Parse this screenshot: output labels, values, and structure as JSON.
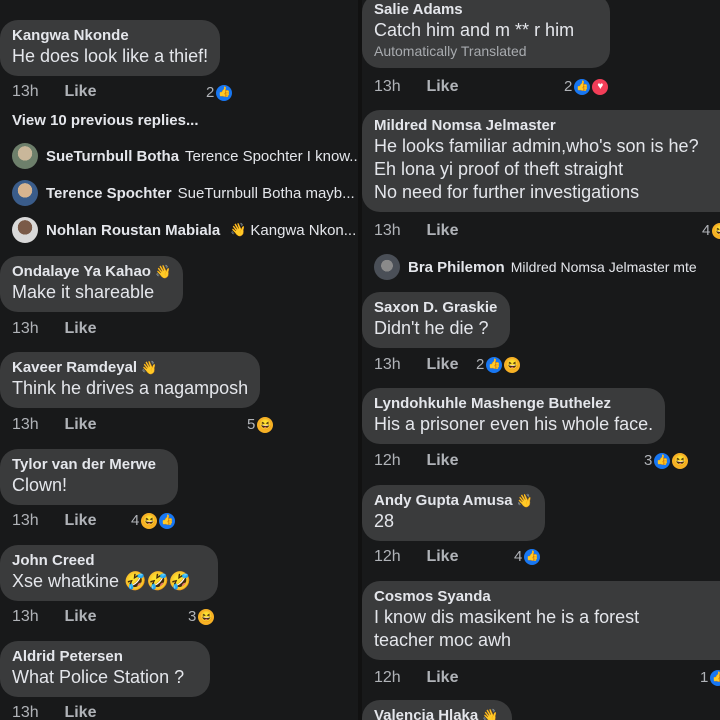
{
  "left": {
    "c1": {
      "name": "Kangwa Nkonde",
      "text": "He does look like a thief!",
      "time": "13h",
      "like": "Like",
      "count": "2"
    },
    "view_prev": "View 10 previous replies...",
    "replies": [
      {
        "name": "SueTurnbull Botha",
        "text": "Terence Spochter I know..."
      },
      {
        "name": "Terence Spochter",
        "text": "SueTurnbull Botha mayb..."
      },
      {
        "name": "Nohlan Roustan Mabiala",
        "text": "Kangwa Nkon..."
      }
    ],
    "c2": {
      "name": "Ondalaye Ya Kahao",
      "text": "Make it shareable",
      "time": "13h",
      "like": "Like"
    },
    "c3": {
      "name": "Kaveer Ramdeyal",
      "text": "Think he drives a nagamposh",
      "time": "13h",
      "like": "Like",
      "count": "5"
    },
    "c4": {
      "name": "Tylor van der Merwe",
      "text": "Clown!",
      "time": "13h",
      "like": "Like",
      "count": "4"
    },
    "c5": {
      "name": "John Creed",
      "text": "Xse whatkine",
      "emojis": "🤣🤣🤣",
      "time": "13h",
      "like": "Like",
      "count": "3"
    },
    "c6": {
      "name": "Aldrid Petersen",
      "text": "What Police Station ?",
      "time": "13h",
      "like": "Like"
    }
  },
  "right": {
    "c1": {
      "name": "Salie Adams",
      "text": "Catch him and m ** r him",
      "sub": "Automatically Translated",
      "time": "13h",
      "like": "Like",
      "count": "2"
    },
    "c2": {
      "name": "Mildred Nomsa Jelmaster",
      "lines": [
        "He looks familiar admin,who's son is he?",
        "Eh lona yi proof of theft straight",
        "No need for further investigations"
      ],
      "time": "13h",
      "like": "Like",
      "count": "4"
    },
    "reply": {
      "name": "Bra Philemon",
      "text": "Mildred Nomsa Jelmaster mte"
    },
    "c3": {
      "name": "Saxon D. Graskie",
      "text": "Didn't he die ?",
      "time": "13h",
      "like": "Like",
      "count": "2"
    },
    "c4": {
      "name": "Lyndohkuhle Mashenge Buthelez",
      "text": "His a prisoner even his whole face.",
      "time": "12h",
      "like": "Like",
      "count": "3"
    },
    "c5": {
      "name": "Andy Gupta Amusa",
      "text": "28",
      "time": "12h",
      "like": "Like",
      "count": "4"
    },
    "c6": {
      "name": "Cosmos Syanda",
      "lines": [
        "I know dis masikent he is a forest",
        "teacher moc awh"
      ],
      "time": "12h",
      "like": "Like",
      "count": "1"
    },
    "c7": {
      "name": "Valencia Hlaka"
    }
  },
  "icons": {
    "like": "thumbs-up-icon",
    "love": "heart-icon",
    "haha": "laugh-emoji-icon",
    "wave": "wave-hand-icon"
  },
  "colors": {
    "bg": "#18191a",
    "bubble": "#3a3b3c",
    "like_blue": "#1877f2",
    "love_red": "#f33e58"
  }
}
